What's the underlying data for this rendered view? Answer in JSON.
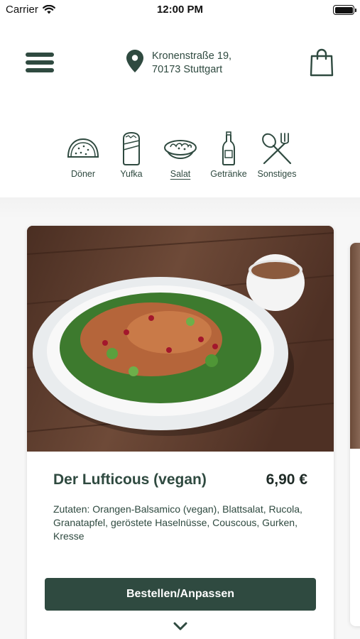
{
  "status_bar": {
    "carrier": "Carrier",
    "time": "12:00 PM"
  },
  "header": {
    "address_line1": "Kronenstraße 19,",
    "address_line2": "70173 Stuttgart"
  },
  "categories": [
    {
      "label": "Döner",
      "icon": "doner-icon",
      "active": false
    },
    {
      "label": "Yufka",
      "icon": "wrap-icon",
      "active": false
    },
    {
      "label": "Salat",
      "icon": "salad-bowl-icon",
      "active": true
    },
    {
      "label": "Getränke",
      "icon": "bottle-icon",
      "active": false
    },
    {
      "label": "Sonstiges",
      "icon": "cutlery-icon",
      "active": false
    }
  ],
  "product": {
    "title": "Der Lufticous (vegan)",
    "price": "6,90 €",
    "description": "Zutaten: Orangen-Balsamico (vegan), Blattsalat, Rucola, Granatapfel, geröstete Haselnüsse, Couscous, Gurken, Kresse",
    "order_label": "Bestellen/Anpassen"
  },
  "colors": {
    "brand": "#2f4a40",
    "background": "#f7f7f7",
    "card": "#ffffff"
  }
}
